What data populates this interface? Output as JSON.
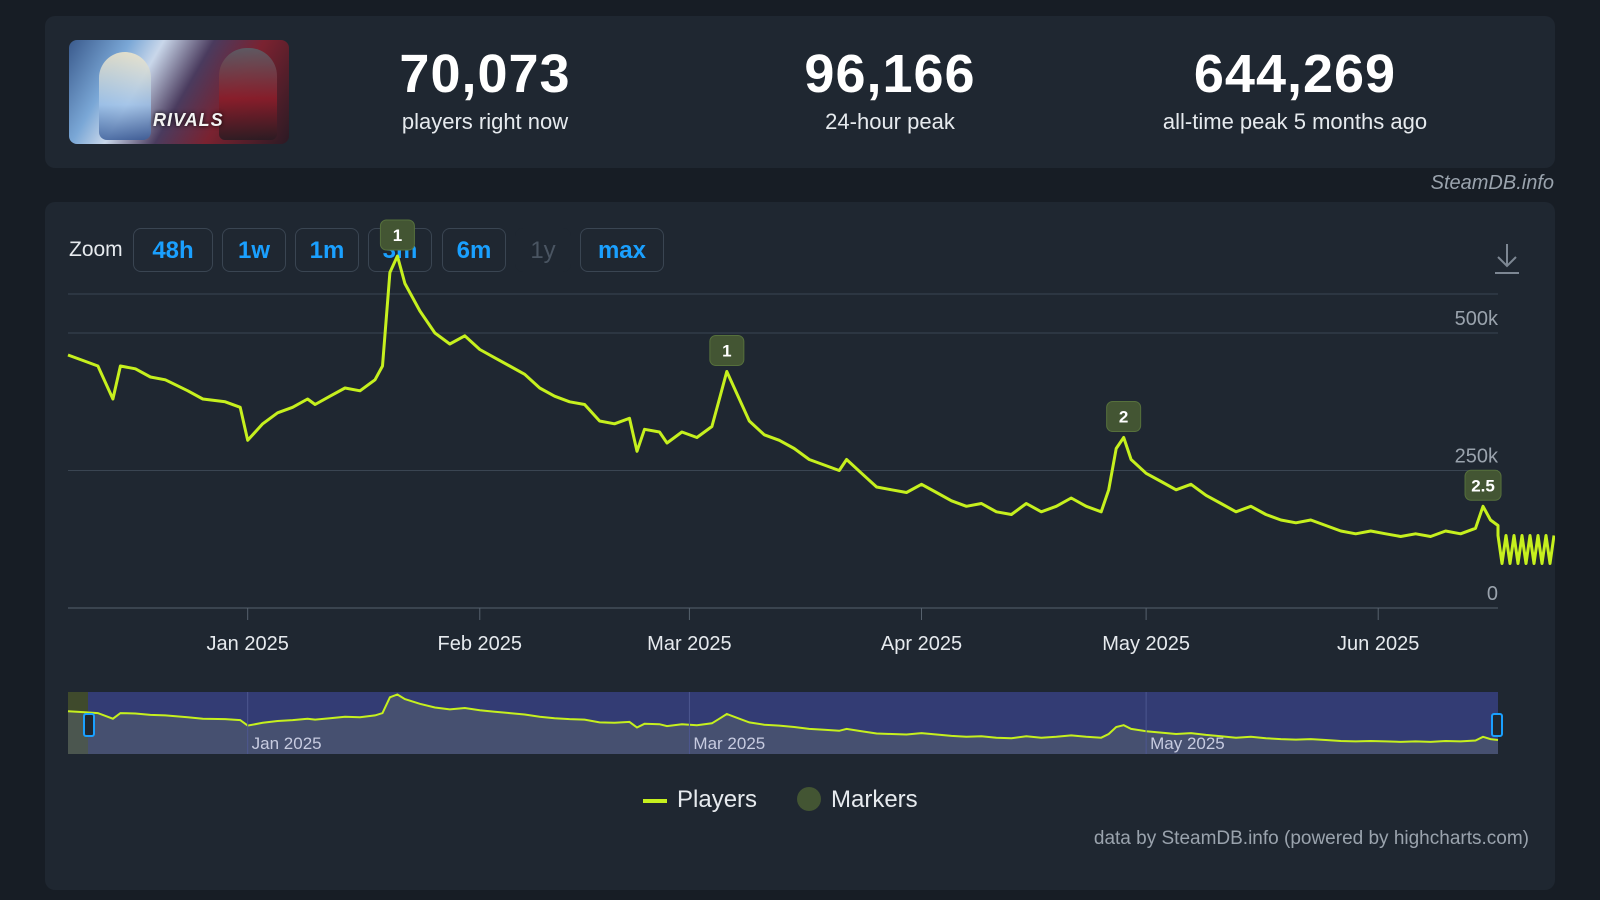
{
  "stats": [
    {
      "value": "70,073",
      "label": "players right now"
    },
    {
      "value": "96,166",
      "label": "24-hour peak"
    },
    {
      "value": "644,269",
      "label": "all-time peak 5 months ago"
    }
  ],
  "thumbnail": {
    "logo_text": "RIVALS"
  },
  "watermark": "SteamDB.info",
  "toolbar": {
    "zoom_label": "Zoom",
    "buttons": [
      "48h",
      "1w",
      "1m",
      "3m",
      "6m",
      "1y",
      "max"
    ],
    "disabled": "1y",
    "download_icon": "download-icon"
  },
  "legend": {
    "players": "Players",
    "markers": "Markers"
  },
  "credits": "data by SteamDB.info (powered by highcharts.com)",
  "chart_data": {
    "type": "line",
    "series": [
      {
        "name": "Players",
        "color": "#c6f01e"
      }
    ],
    "x_start": "2024-12-08",
    "x_end": "2025-06-17",
    "ylim": [
      0,
      600000
    ],
    "ytick_labels": [
      "0",
      "250k",
      "500k"
    ],
    "yticks": [
      0,
      250000,
      500000
    ],
    "xtick_labels": [
      "Jan 2025",
      "Feb 2025",
      "Mar 2025",
      "Apr 2025",
      "May 2025",
      "Jun 2025"
    ],
    "xticks": [
      "2025-01-01",
      "2025-02-01",
      "2025-03-01",
      "2025-04-01",
      "2025-05-01",
      "2025-06-01"
    ],
    "points": [
      [
        "2024-12-08",
        460000
      ],
      [
        "2024-12-10",
        450000
      ],
      [
        "2024-12-12",
        440000
      ],
      [
        "2024-12-14",
        380000
      ],
      [
        "2024-12-15",
        440000
      ],
      [
        "2024-12-17",
        435000
      ],
      [
        "2024-12-19",
        420000
      ],
      [
        "2024-12-21",
        415000
      ],
      [
        "2024-12-24",
        395000
      ],
      [
        "2024-12-26",
        380000
      ],
      [
        "2024-12-29",
        375000
      ],
      [
        "2024-12-31",
        365000
      ],
      [
        "2025-01-01",
        305000
      ],
      [
        "2025-01-03",
        335000
      ],
      [
        "2025-01-05",
        355000
      ],
      [
        "2025-01-07",
        365000
      ],
      [
        "2025-01-09",
        380000
      ],
      [
        "2025-01-10",
        370000
      ],
      [
        "2025-01-12",
        385000
      ],
      [
        "2025-01-14",
        400000
      ],
      [
        "2025-01-16",
        395000
      ],
      [
        "2025-01-18",
        415000
      ],
      [
        "2025-01-19",
        440000
      ],
      [
        "2025-01-20",
        610000
      ],
      [
        "2025-01-21",
        640000
      ],
      [
        "2025-01-22",
        590000
      ],
      [
        "2025-01-24",
        540000
      ],
      [
        "2025-01-26",
        500000
      ],
      [
        "2025-01-28",
        480000
      ],
      [
        "2025-01-30",
        495000
      ],
      [
        "2025-02-01",
        470000
      ],
      [
        "2025-02-03",
        455000
      ],
      [
        "2025-02-05",
        440000
      ],
      [
        "2025-02-07",
        425000
      ],
      [
        "2025-02-09",
        400000
      ],
      [
        "2025-02-11",
        385000
      ],
      [
        "2025-02-13",
        375000
      ],
      [
        "2025-02-15",
        370000
      ],
      [
        "2025-02-17",
        340000
      ],
      [
        "2025-02-19",
        335000
      ],
      [
        "2025-02-21",
        345000
      ],
      [
        "2025-02-22",
        285000
      ],
      [
        "2025-02-23",
        325000
      ],
      [
        "2025-02-25",
        320000
      ],
      [
        "2025-02-26",
        300000
      ],
      [
        "2025-02-28",
        320000
      ],
      [
        "2025-03-02",
        310000
      ],
      [
        "2025-03-04",
        330000
      ],
      [
        "2025-03-05",
        380000
      ],
      [
        "2025-03-06",
        430000
      ],
      [
        "2025-03-07",
        400000
      ],
      [
        "2025-03-09",
        340000
      ],
      [
        "2025-03-11",
        315000
      ],
      [
        "2025-03-13",
        305000
      ],
      [
        "2025-03-15",
        290000
      ],
      [
        "2025-03-17",
        270000
      ],
      [
        "2025-03-19",
        260000
      ],
      [
        "2025-03-21",
        250000
      ],
      [
        "2025-03-22",
        270000
      ],
      [
        "2025-03-24",
        245000
      ],
      [
        "2025-03-26",
        220000
      ],
      [
        "2025-03-28",
        215000
      ],
      [
        "2025-03-30",
        210000
      ],
      [
        "2025-04-01",
        225000
      ],
      [
        "2025-04-03",
        210000
      ],
      [
        "2025-04-05",
        195000
      ],
      [
        "2025-04-07",
        185000
      ],
      [
        "2025-04-09",
        190000
      ],
      [
        "2025-04-11",
        175000
      ],
      [
        "2025-04-13",
        170000
      ],
      [
        "2025-04-15",
        190000
      ],
      [
        "2025-04-17",
        175000
      ],
      [
        "2025-04-19",
        185000
      ],
      [
        "2025-04-21",
        200000
      ],
      [
        "2025-04-23",
        185000
      ],
      [
        "2025-04-25",
        175000
      ],
      [
        "2025-04-26",
        215000
      ],
      [
        "2025-04-27",
        290000
      ],
      [
        "2025-04-28",
        310000
      ],
      [
        "2025-04-29",
        270000
      ],
      [
        "2025-05-01",
        245000
      ],
      [
        "2025-05-03",
        230000
      ],
      [
        "2025-05-05",
        215000
      ],
      [
        "2025-05-07",
        225000
      ],
      [
        "2025-05-09",
        205000
      ],
      [
        "2025-05-11",
        190000
      ],
      [
        "2025-05-13",
        175000
      ],
      [
        "2025-05-15",
        185000
      ],
      [
        "2025-05-17",
        170000
      ],
      [
        "2025-05-19",
        160000
      ],
      [
        "2025-05-21",
        155000
      ],
      [
        "2025-05-23",
        160000
      ],
      [
        "2025-05-25",
        150000
      ],
      [
        "2025-05-27",
        140000
      ],
      [
        "2025-05-29",
        135000
      ],
      [
        "2025-05-31",
        140000
      ],
      [
        "2025-06-02",
        135000
      ],
      [
        "2025-06-04",
        130000
      ],
      [
        "2025-06-06",
        135000
      ],
      [
        "2025-06-08",
        130000
      ],
      [
        "2025-06-10",
        140000
      ],
      [
        "2025-06-12",
        135000
      ],
      [
        "2025-06-14",
        145000
      ],
      [
        "2025-06-15",
        185000
      ],
      [
        "2025-06-16",
        160000
      ],
      [
        "2025-06-17",
        150000
      ]
    ],
    "markers": [
      {
        "date": "2025-01-21",
        "value": 640000,
        "label": "1"
      },
      {
        "date": "2025-03-06",
        "value": 430000,
        "label": "1"
      },
      {
        "date": "2025-04-28",
        "value": 310000,
        "label": "2"
      },
      {
        "date": "2025-06-15",
        "value": 185000,
        "label": "2.5"
      }
    ],
    "navigator": {
      "xtick_labels": [
        "Jan 2025",
        "Mar 2025",
        "May 2025"
      ]
    }
  }
}
